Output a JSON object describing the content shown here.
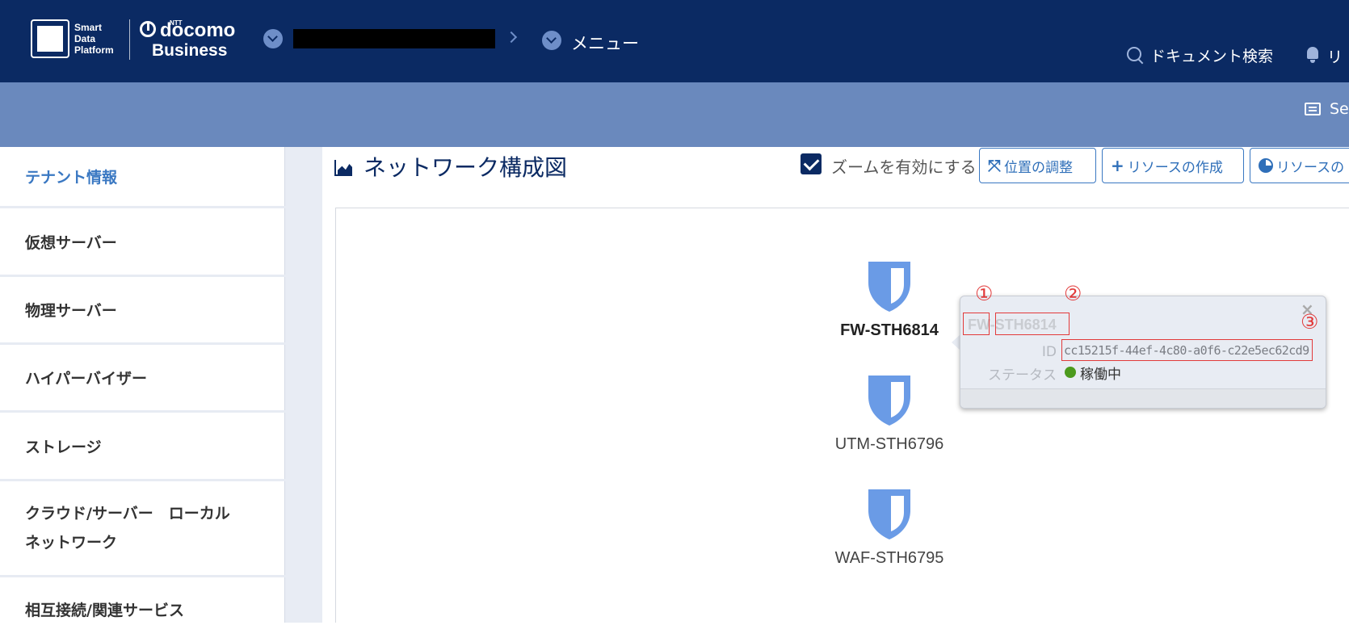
{
  "header": {
    "brand": {
      "sdp_line1": "Smart",
      "sdp_line2": "Data",
      "sdp_line3": "Platform",
      "ntt": "NTT",
      "docomo": "docomo",
      "business": "Business"
    },
    "breadcrumb": {
      "tenant": "",
      "menu": "メニュー"
    },
    "doc_search": "ドキュメント検索",
    "notifications_label": "リ"
  },
  "band": {
    "label": "Se"
  },
  "sidebar": {
    "items": [
      {
        "label": "テナント情報",
        "active": true
      },
      {
        "label": "仮想サーバー"
      },
      {
        "label": "物理サーバー"
      },
      {
        "label": "ハイパーバイザー"
      },
      {
        "label": "ストレージ"
      },
      {
        "label_line1": "クラウド/サーバー　ローカル",
        "label_line2": "ネットワーク"
      },
      {
        "label": "相互接続/関連サービス"
      }
    ]
  },
  "main": {
    "title": "ネットワーク構成図",
    "zoom_label": "ズームを有効にする",
    "zoom_checked": true,
    "buttons": {
      "adjust": "位置の調整",
      "create": "リソースの作成",
      "other": "リソースの"
    }
  },
  "nodes": [
    {
      "label": "FW-STH6814",
      "selected": true
    },
    {
      "label": "UTM-STH6796"
    },
    {
      "label": "WAF-STH6795"
    }
  ],
  "popup": {
    "close": "×",
    "title": "FW-STH6814",
    "id_key": "ID",
    "id_value": "cc15215f-44ef-4c80-a0f6-c22e5ec62cd9",
    "status_key": "ステータス",
    "status_value": "稼働中",
    "status_color": "#4c9a1d"
  },
  "annotations": [
    "①",
    "②",
    "③"
  ],
  "colors": {
    "header_bg": "#0b2a63",
    "band_bg": "#6a89bd",
    "accent": "#3a78c2",
    "shield": "#6a9be6",
    "annotation": "#e23a3a"
  }
}
